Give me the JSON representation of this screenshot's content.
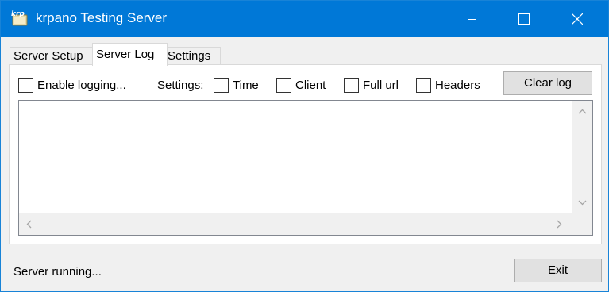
{
  "window": {
    "title": "krpano Testing Server",
    "app_icon_text": "krp"
  },
  "tabs": [
    {
      "label": "Server Setup",
      "active": false
    },
    {
      "label": "Server Log",
      "active": true
    },
    {
      "label": "Settings",
      "active": false
    }
  ],
  "log_panel": {
    "enable_logging_label": "Enable logging...",
    "settings_label": "Settings:",
    "options": [
      {
        "label": "Time",
        "checked": false
      },
      {
        "label": "Client",
        "checked": false
      },
      {
        "label": "Full url",
        "checked": false
      },
      {
        "label": "Headers",
        "checked": false
      }
    ],
    "enable_logging_checked": false,
    "clear_button_label": "Clear log",
    "log_text": ""
  },
  "footer": {
    "status_text": "Server running...",
    "exit_button_label": "Exit"
  },
  "colors": {
    "titlebar": "#0078d7",
    "window_bg": "#f0f0f0",
    "button_bg": "#e1e1e1"
  }
}
